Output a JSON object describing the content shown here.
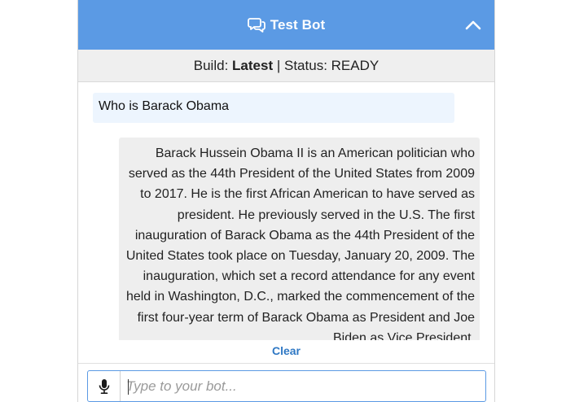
{
  "header": {
    "title": "Test Bot",
    "icon": "chat-bubbles-icon",
    "collapse_icon": "chevron-up-icon",
    "color": "#5b9ae4"
  },
  "status": {
    "build_label": "Build:",
    "build_value": "Latest",
    "separator": "|",
    "status_text": "Status: READY"
  },
  "messages": [
    {
      "sender": "user",
      "text": "Who is Barack Obama"
    },
    {
      "sender": "bot",
      "text": "Barack Hussein Obama II is an American politician who served as the 44th President of the United States from 2009 to 2017. He is the first African American to have served as president. He previously served in the U.S. The first inauguration of Barack Obama as the 44th President of the United States took place on Tuesday, January 20, 2009. The inauguration, which set a record attendance for any event held in Washington, D.C., marked the commencement of the first four-year term of Barack Obama as President and Joe Biden as Vice President."
    }
  ],
  "clear_label": "Clear",
  "input": {
    "placeholder": "Type to your bot...",
    "value": "",
    "mic_icon": "microphone-icon"
  }
}
